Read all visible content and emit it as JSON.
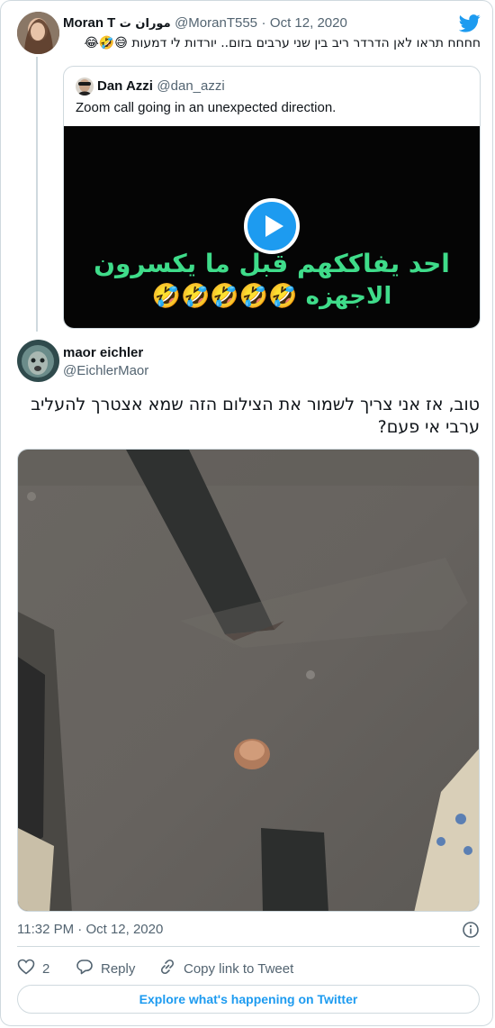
{
  "reply_to": {
    "display_name": "Moran T",
    "display_name_extra": "موران ت",
    "handle": "@MoranT555",
    "separator": "·",
    "date": "Oct 12, 2020",
    "text": "חחחח תראו לאן הדרדר ריב בין שני ערבים בזום.. יורדות לי דמעות 😅🤣😂"
  },
  "quoted_tweet": {
    "display_name": "Dan Azzi",
    "handle": "@dan_azzi",
    "text": "Zoom call going in an unexpected direction.",
    "video_caption_line1": "احد يفاككهم قبل ما يكسرون",
    "video_caption_line2": "الاجهزه 🤣🤣🤣🤣🤣"
  },
  "main_tweet": {
    "display_name": "maor eichler",
    "handle": "@EichlerMaor",
    "text": "טוב, אז אני צריך לשמור את הצילום הזה שמא אצטרך להעליב ערבי אי פעם?",
    "time": "11:32 PM",
    "separator": "·",
    "date": "Oct 12, 2020"
  },
  "actions": {
    "like_count": "2",
    "reply_label": "Reply",
    "copy_link_label": "Copy link to Tweet"
  },
  "footer": {
    "explore_label": "Explore what's happening on Twitter"
  },
  "colors": {
    "accent": "#1d9bf0",
    "muted": "#536471",
    "border": "#cfd9de",
    "caption_green": "#3fdc8a"
  },
  "icons": [
    "twitter-bird-icon",
    "play-icon",
    "info-icon",
    "heart-icon",
    "reply-icon",
    "link-icon"
  ]
}
